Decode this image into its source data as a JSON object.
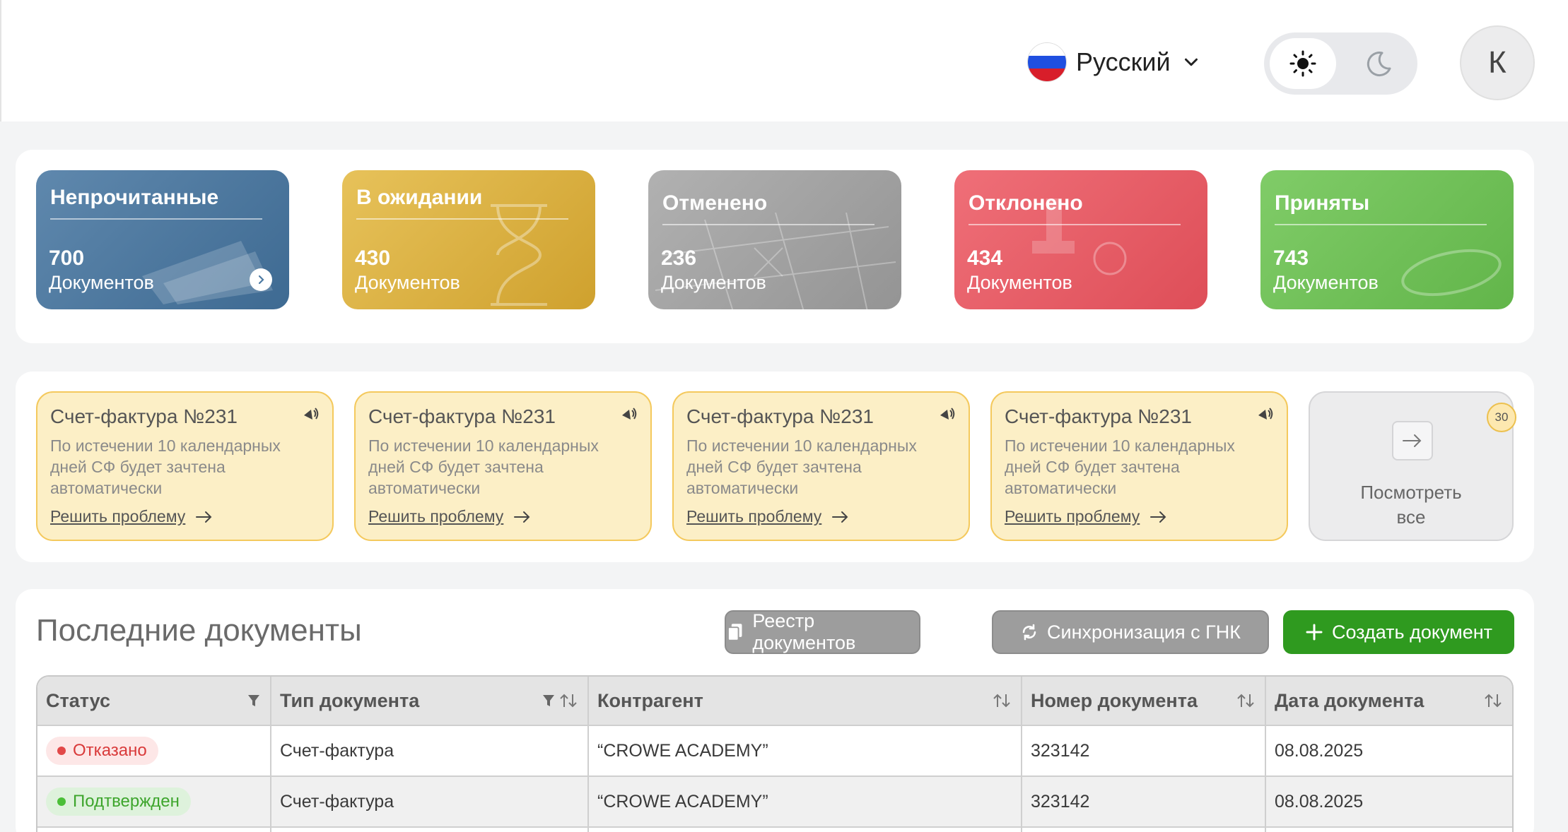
{
  "header": {
    "language": "Русский",
    "avatar_initial": "К",
    "flag_colors": [
      "#ffffff",
      "#1f4fe0",
      "#d81e2a"
    ]
  },
  "status_cards": [
    {
      "title": "Непрочитанные",
      "count": "700",
      "label": "Документов",
      "color": "#4d7aa3"
    },
    {
      "title": "В ожидании",
      "count": "430",
      "label": "Документов",
      "color": "#ddb342"
    },
    {
      "title": "Отменено",
      "count": "236",
      "label": "Документов",
      "color": "#a3a3a3"
    },
    {
      "title": "Отклонено",
      "count": "434",
      "label": "Документов",
      "color": "#ea5e68"
    },
    {
      "title": "Приняты",
      "count": "743",
      "label": "Документов",
      "color": "#72c25b"
    }
  ],
  "notifications": [
    {
      "title": "Счет-фактура №231",
      "desc": "По истечении 10 календарных дней СФ будет зачтена автоматически",
      "link": "Решить проблему"
    },
    {
      "title": "Счет-фактура №231",
      "desc": "По истечении 10 календарных дней СФ будет зачтена автоматически",
      "link": "Решить проблему"
    },
    {
      "title": "Счет-фактура №231",
      "desc": "По истечении 10 календарных дней СФ будет зачтена автоматически",
      "link": "Решить проблему"
    },
    {
      "title": "Счет-фактура №231",
      "desc": "По истечении 10 календарных дней СФ будет зачтена автоматически",
      "link": "Решить проблему"
    }
  ],
  "view_all": {
    "label": "Посмотреть все",
    "count": "30"
  },
  "recent": {
    "title": "Последние документы",
    "btn_registry": "Реестр документов",
    "btn_sync": "Синхронизация с ГНК",
    "btn_create": "Создать документ",
    "columns": [
      "Статус",
      "Тип документа",
      "Контрагент",
      "Номер документа",
      "Дата документа"
    ],
    "rows": [
      {
        "status": "Отказано",
        "status_type": "red",
        "type": "Счет-фактура",
        "counterparty": "“CROWE ACADEMY”",
        "number": "323142",
        "date": "08.08.2025"
      },
      {
        "status": "Подтвержден",
        "status_type": "green",
        "type": "Счет-фактура",
        "counterparty": "“CROWE ACADEMY”",
        "number": "323142",
        "date": "08.08.2025"
      }
    ]
  }
}
